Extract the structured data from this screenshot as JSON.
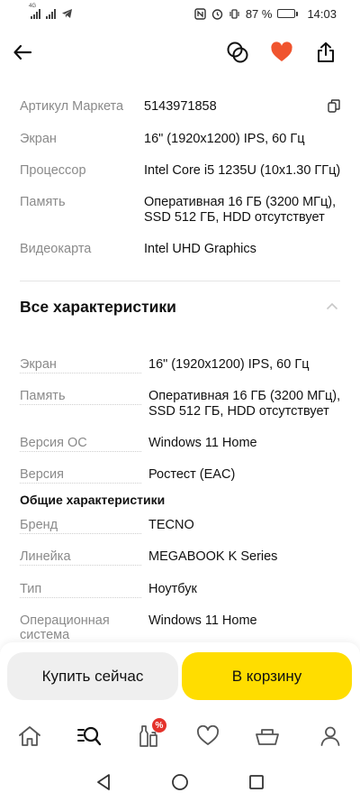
{
  "status_bar": {
    "network_tag": "4G",
    "battery_percent_text": "87 %",
    "battery_level": 0.87,
    "time": "14:03"
  },
  "colors": {
    "accent_yellow": "#ffdd00",
    "favorite_red": "#f0542e",
    "badge_red": "#e4322b",
    "label_gray": "#8a8a8a"
  },
  "top_bar": {
    "icons": [
      "back-arrow-icon",
      "compare-icon",
      "heart-icon",
      "share-icon"
    ]
  },
  "short_specs": [
    {
      "label": "Артикул Маркета",
      "value": "5143971858"
    },
    {
      "label": "Экран",
      "value": "16\" (1920x1200) IPS, 60 Гц"
    },
    {
      "label": "Процессор",
      "value": "Intel Core i5 1235U (10x1.30 ГГц)"
    },
    {
      "label": "Память",
      "value_line1": "Оперативная 16 ГБ (3200 МГц),",
      "value_line2": "SSD 512 ГБ, HDD отсутствует"
    },
    {
      "label": "Видеокарта",
      "value": "Intel UHD Graphics"
    }
  ],
  "all_specs": {
    "title": "Все характеристики",
    "main": [
      {
        "label": "Экран",
        "value": "16\" (1920x1200) IPS, 60 Гц"
      },
      {
        "label": "Память",
        "value_line1": "Оперативная 16 ГБ (3200 МГц),",
        "value_line2": "SSD 512 ГБ, HDD отсутствует"
      },
      {
        "label": "Версия ОС",
        "value": "Windows 11 Home"
      },
      {
        "label": "Версия",
        "value": "Ростест (EAC)"
      }
    ],
    "general_title": "Общие характеристики",
    "general": [
      {
        "label": "Бренд",
        "value": "TECNO"
      },
      {
        "label": "Линейка",
        "value": "MEGABOOK K Series"
      },
      {
        "label": "Тип",
        "value": "Ноутбук"
      },
      {
        "label_line1": "Операционная",
        "label_line2": "система",
        "value": "Windows 11 Home"
      }
    ]
  },
  "actions": {
    "buy_now": "Купить сейчас",
    "add_to_cart": "В корзину"
  },
  "tab_bar": {
    "badge": "%",
    "icons": [
      "home-icon",
      "catalog-search-icon",
      "bottles-icon",
      "favorites-icon",
      "cart-icon",
      "profile-icon"
    ]
  }
}
